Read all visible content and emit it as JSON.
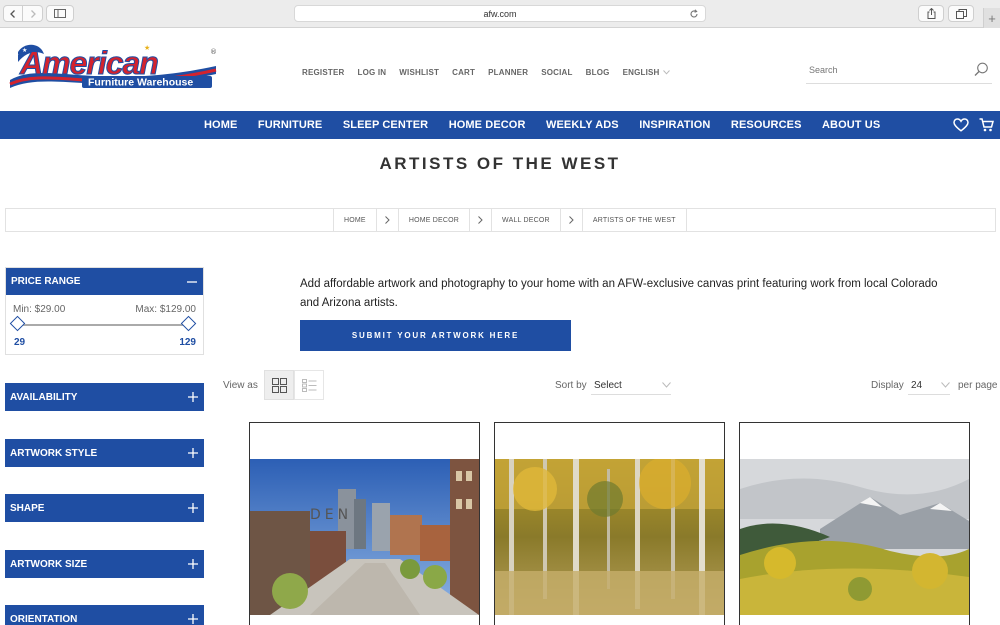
{
  "browser": {
    "url": "afw.com"
  },
  "site": {
    "logo_text_primary": "American",
    "logo_text_secondary": "Furniture Warehouse",
    "logo_mark": "®"
  },
  "top_links": [
    {
      "label": "REGISTER"
    },
    {
      "label": "LOG IN"
    },
    {
      "label": "WISHLIST"
    },
    {
      "label": "CART"
    },
    {
      "label": "PLANNER"
    },
    {
      "label": "SOCIAL"
    },
    {
      "label": "BLOG"
    },
    {
      "label": "ENGLISH"
    }
  ],
  "search": {
    "placeholder": "Search",
    "value": ""
  },
  "main_nav": [
    {
      "label": "HOME"
    },
    {
      "label": "FURNITURE"
    },
    {
      "label": "SLEEP CENTER"
    },
    {
      "label": "HOME DECOR"
    },
    {
      "label": "WEEKLY ADS"
    },
    {
      "label": "INSPIRATION"
    },
    {
      "label": "RESOURCES"
    },
    {
      "label": "ABOUT US"
    }
  ],
  "page": {
    "title": "ARTISTS OF THE WEST"
  },
  "breadcrumb": [
    {
      "label": "HOME"
    },
    {
      "label": "HOME DECOR"
    },
    {
      "label": "WALL DECOR"
    },
    {
      "label": "ARTISTS OF THE WEST"
    }
  ],
  "filters": {
    "price": {
      "label": "PRICE RANGE",
      "min_text": "Min: $29.00",
      "max_text": "Max: $129.00",
      "slider_min": "29",
      "slider_max": "129"
    },
    "groups": [
      {
        "label": "AVAILABILITY"
      },
      {
        "label": "ARTWORK STYLE"
      },
      {
        "label": "SHAPE"
      },
      {
        "label": "ARTWORK SIZE"
      },
      {
        "label": "ORIENTATION"
      }
    ]
  },
  "content": {
    "intro": "Add affordable artwork and photography to your home with an AFW-exclusive canvas print featuring work from local Colorado and Arizona artists.",
    "submit_label": "SUBMIT YOUR ARTWORK HERE"
  },
  "toolbar": {
    "view_as_label": "View as",
    "sort_label": "Sort by",
    "sort_value": "Select",
    "display_label": "Display",
    "display_value": "24",
    "per_page_label": "per page"
  },
  "colors": {
    "brand_blue": "#1f4ea3",
    "logo_red": "#d3232e"
  },
  "icons": [
    "back-icon",
    "forward-icon",
    "sidebar-icon",
    "reload-icon",
    "share-icon",
    "tabs-icon",
    "search-icon",
    "heart-icon",
    "cart-icon",
    "plus-icon",
    "minus-icon",
    "grid-icon",
    "list-icon"
  ]
}
